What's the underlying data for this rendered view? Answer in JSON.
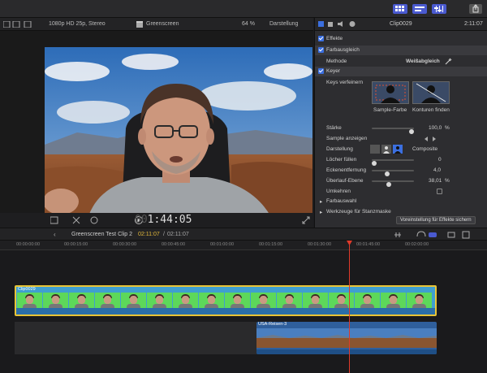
{
  "viewer": {
    "format": "1080p HD 25p, Stereo",
    "project": "Greenscreen",
    "zoom": "64 %",
    "view_menu": "Darstellung",
    "timecode_dim": "00",
    "timecode": "1:44:05"
  },
  "inspector": {
    "clip_name": "Clip0029",
    "duration": "2:11:07",
    "effects": "Effekte",
    "color_balance": "Farbausgleich",
    "method_label": "Methode",
    "method_value": "Weißabgleich",
    "keyer": "Keyer",
    "refine_label": "Keys verfeinern",
    "sample_color": "Sample-Farbe",
    "edges": "Konturen finden",
    "strength_label": "Stärke",
    "strength_value": "100,0",
    "strength_unit": "%",
    "strength_fraction": 1.0,
    "show_sample": "Sample anzeigen",
    "display_label": "Darstellung",
    "display_value": "Composite",
    "fill_holes_label": "Löcher füllen",
    "fill_holes_value": "0",
    "edge_dist_label": "Eckenentfernung",
    "edge_dist_value": "4,0",
    "spill_label": "Überlauf-Ebene",
    "spill_value": "38,01",
    "spill_unit": "%",
    "invert_label": "Umkehren",
    "color_select": "Farbauswahl",
    "matte_tools": "Werkzeuge für Stanzmaske",
    "save_preset": "Voreinstellung für Effekte sichern"
  },
  "timeline": {
    "clip_label": "Greenscreen Test Clip 2",
    "position": "02:11:07",
    "separator": "/",
    "total": "02:11:07",
    "ruler": [
      "00:00:00:00",
      "00:00:15:00",
      "00:00:30:00",
      "00:00:45:00",
      "00:01:00:00",
      "00:01:15:00",
      "00:01:30:00",
      "00:01:45:00",
      "00:02:00:00"
    ],
    "main_clip": "Clip0029",
    "bg_clip": "USA-Reisen-3"
  }
}
